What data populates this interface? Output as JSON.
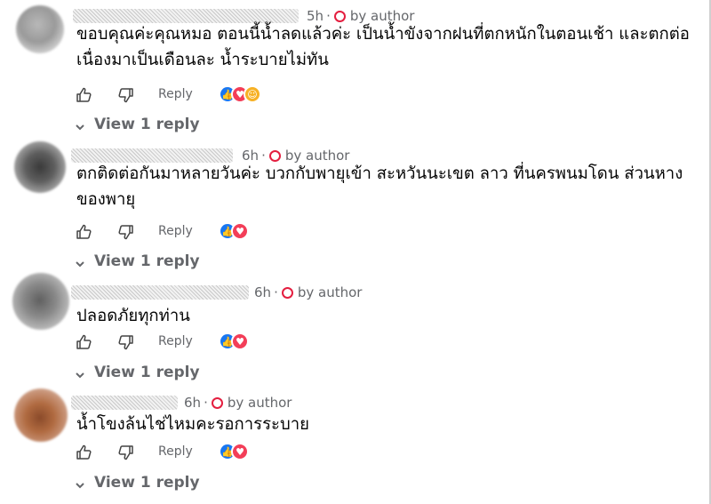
{
  "comments": [
    {
      "time": "5h",
      "author_badge": "by author",
      "text": "ขอบคุณค่ะคุณหมอ ตอนนี้น้ำลดแล้วค่ะ เป็นน้ำขังจากฝนที่ตกหนักในตอนเช้า และตกต่อเนื่องมาเป็นเดือนละ น้ำระบายไม่ทัน",
      "reply_label": "Reply",
      "reactions": [
        "like",
        "love",
        "care"
      ],
      "view_replies": "View 1 reply"
    },
    {
      "time": "6h",
      "author_badge": "by author",
      "text": "ตกติดต่อกันมาหลายวันค่ะ บวกกับพายุเข้า สะหวันนะเขต ลาว ที่นครพนมโดน ส่วนหางของพายุ",
      "reply_label": "Reply",
      "reactions": [
        "like",
        "love"
      ],
      "view_replies": "View 1 reply"
    },
    {
      "time": "6h",
      "author_badge": "by author",
      "text": "ปลอดภัยทุกท่าน",
      "reply_label": "Reply",
      "reactions": [
        "like",
        "love"
      ],
      "view_replies": "View 1 reply"
    },
    {
      "time": "6h",
      "author_badge": "by author",
      "text": "น้ำโขงล้นไช่ไหมคะรอการระบาย",
      "reply_label": "Reply",
      "reactions": [
        "like",
        "love"
      ],
      "view_replies": "View 1 reply"
    }
  ],
  "colors": {
    "text": "#050505",
    "secondary": "#65676b",
    "author_badge": "#e41e3f",
    "like": "#1877f2",
    "love": "#f33e58",
    "care": "#f7b125"
  },
  "icons": {
    "like": "thumbs-up-icon",
    "dislike": "thumbs-down-icon",
    "author": "author-badge-icon",
    "expand": "chevron-down-icon"
  }
}
